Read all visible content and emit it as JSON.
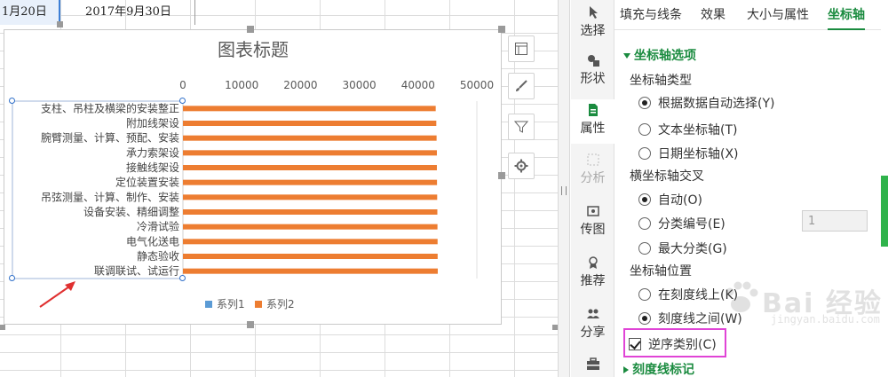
{
  "sheet": {
    "cell_a": "1月20日",
    "cell_b": "2017年9月30日"
  },
  "chart_data": {
    "type": "bar",
    "orientation": "horizontal",
    "title": "图表标题",
    "categories": [
      "支柱、吊柱及横梁的安装整正",
      "附加线架设",
      "腕臂测量、计算、预配、安装",
      "承力索架设",
      "接触线架设",
      "定位装置安装",
      "吊弦测量、计算、制作、安装",
      "设备安装、精细调整",
      "冷滑试验",
      "电气化送电",
      "静态验收",
      "联调联试、试运行"
    ],
    "series": [
      {
        "name": "系列1",
        "color": "#5b9bd5",
        "values": [
          0,
          0,
          0,
          0,
          0,
          0,
          0,
          0,
          0,
          0,
          0,
          0
        ]
      },
      {
        "name": "系列2",
        "color": "#ed7d31",
        "values": [
          43000,
          43100,
          43150,
          43200,
          43200,
          43220,
          43250,
          43280,
          43300,
          43320,
          43330,
          43350
        ]
      }
    ],
    "xlim": [
      0,
      50000
    ],
    "xticks": [
      "0",
      "10000",
      "20000",
      "30000",
      "40000",
      "50000"
    ],
    "x_axis_position": "top",
    "categories_reversed": true,
    "legend_position": "bottom",
    "grid": false
  },
  "side_tools": {
    "select": "选择",
    "shape": "形状",
    "properties": "属性",
    "analysis": "分析",
    "transmit": "传图",
    "recommend": "推荐",
    "share": "分享"
  },
  "panel": {
    "tabs": [
      "填充与线条",
      "效果",
      "大小与属性",
      "坐标轴"
    ],
    "axis_options_title": "坐标轴选项",
    "axis_type_label": "坐标轴类型",
    "axis_type_options": [
      "根据数据自动选择(Y)",
      "文本坐标轴(T)",
      "日期坐标轴(X)"
    ],
    "cross_label": "横坐标轴交叉",
    "cross_options": [
      "自动(O)",
      "分类编号(E)",
      "最大分类(G)"
    ],
    "cross_number": "1",
    "position_label": "坐标轴位置",
    "position_options": [
      "在刻度线上(K)",
      "刻度线之间(W)"
    ],
    "reverse_label": "逆序类别(C)",
    "tick_marks_title": "刻度线标记"
  },
  "watermark": {
    "brand": "Bai 经验",
    "url": "jingyan.baidu.com"
  },
  "colors": {
    "accent": "#1a8b3f",
    "highlight": "#e044d6"
  }
}
